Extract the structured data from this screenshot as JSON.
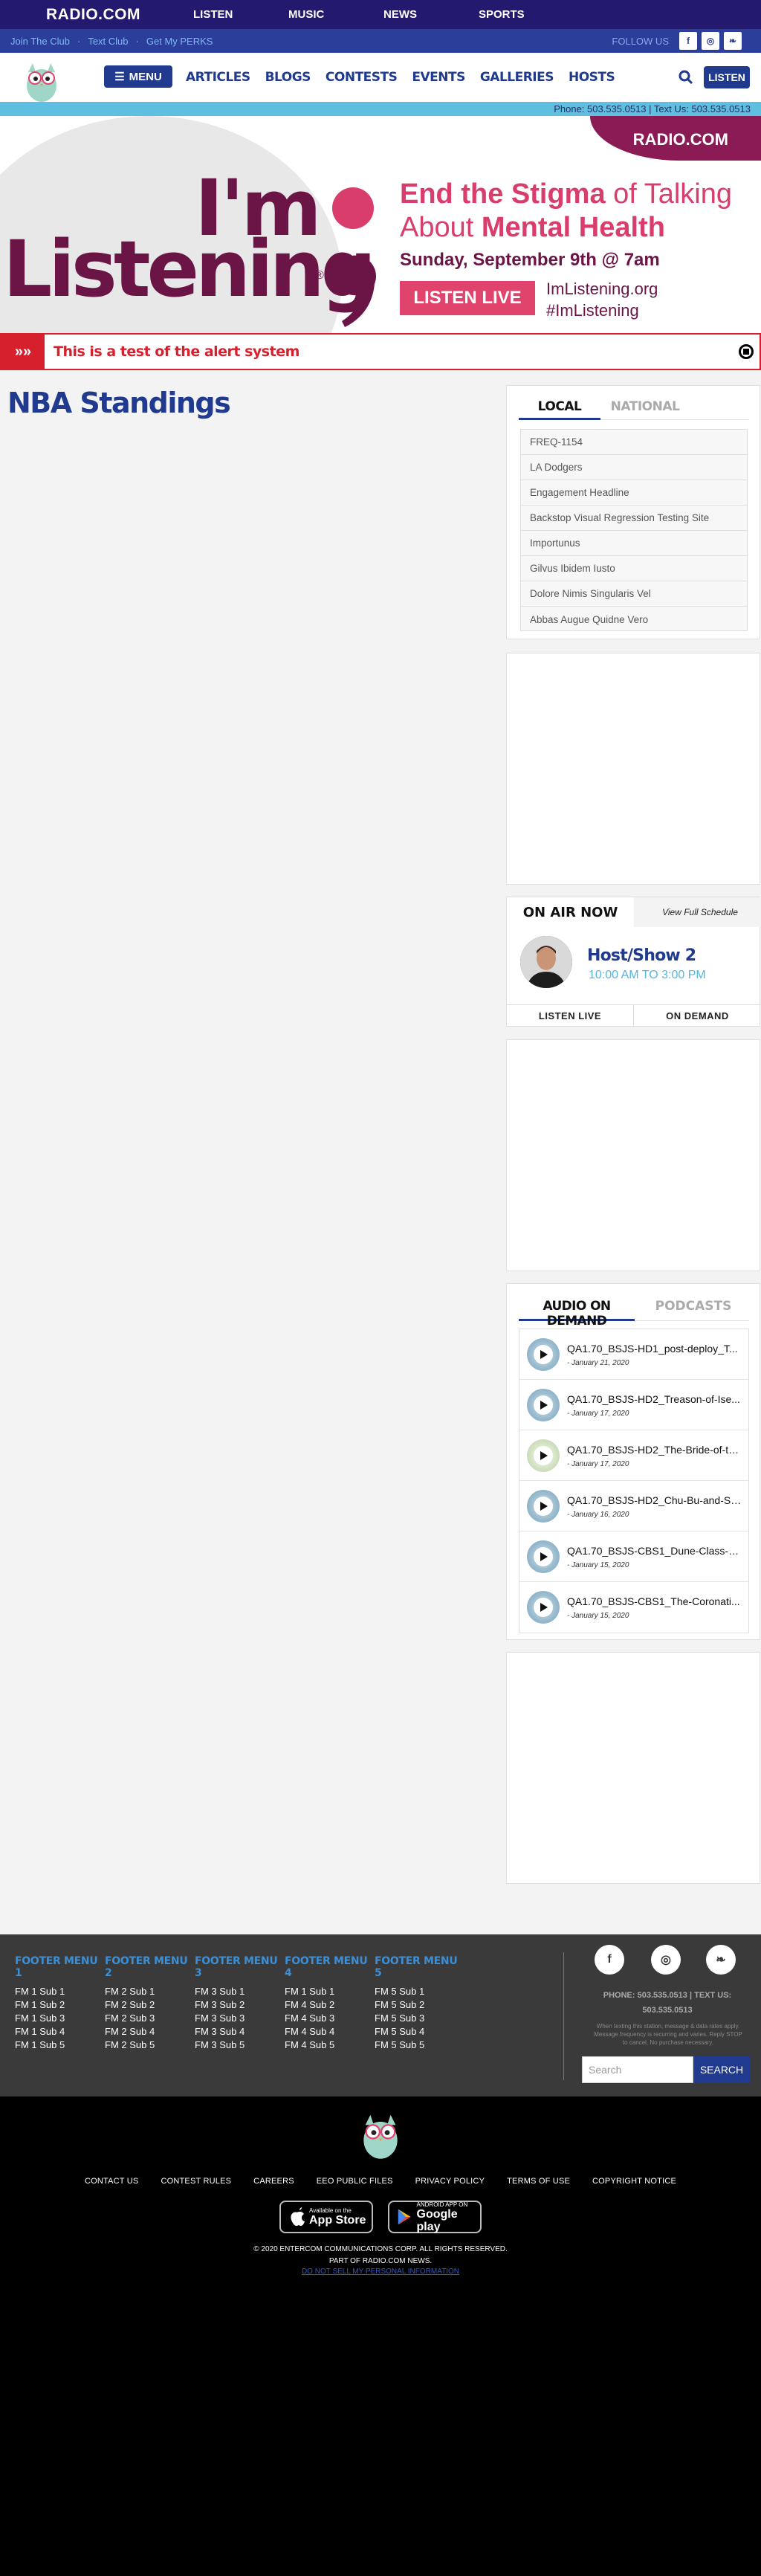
{
  "topnav": {
    "logo": "RADIO.COM",
    "items": [
      "LISTEN",
      "MUSIC",
      "NEWS",
      "SPORTS"
    ]
  },
  "clubbar": {
    "links": [
      "Join The Club",
      "Text Club",
      "Get My PERKS"
    ],
    "follow_label": "FOLLOW US",
    "social": [
      "f",
      "◎",
      "❧"
    ]
  },
  "station": {
    "menu_label": "MENU",
    "nav": [
      "ARTICLES",
      "BLOGS",
      "CONTESTS",
      "EVENTS",
      "GALLERIES",
      "HOSTS"
    ],
    "listen_label": "LISTEN",
    "phone_line": "Phone: 503.535.0513  |  Text Us: 503.535.0513"
  },
  "banner": {
    "radio_logo": "RADIO.COM",
    "im": "I'm",
    "listening": "Listening",
    "reg": "®",
    "headline_a": "End the Stigma",
    "headline_b": " of Talking",
    "headline_c": "About ",
    "headline_d": "Mental Health",
    "date": "Sunday, September 9th @ 7am",
    "cta": "LISTEN LIVE",
    "site": "ImListening.org",
    "hashtag": "#ImListening",
    "colors": {
      "plum": "#6b1547",
      "pink": "#e0446d"
    }
  },
  "alert": {
    "text": "This is a test of the alert system"
  },
  "page": {
    "title": "NBA Standings"
  },
  "trending": {
    "tabs": [
      "LOCAL",
      "NATIONAL"
    ],
    "items": [
      "FREQ-1154",
      "LA Dodgers",
      "Engagement Headline",
      "Backstop Visual Regression Testing Site",
      "Importunus",
      "Gilvus Ibidem Iusto",
      "Dolore Nimis Singularis Vel",
      "Abbas Augue Quidne Vero"
    ]
  },
  "onair": {
    "label": "ON AIR NOW",
    "schedule_link": "View Full Schedule",
    "host": "Host/Show 2",
    "time": "10:00 AM TO 3:00 PM",
    "buttons": [
      "LISTEN LIVE",
      "ON DEMAND"
    ]
  },
  "aod": {
    "tabs": [
      "AUDIO ON DEMAND",
      "PODCASTS"
    ],
    "items": [
      {
        "title": "QA1.70_BSJS-HD1_post-deploy_T...",
        "date": "- January 21, 2020"
      },
      {
        "title": "QA1.70_BSJS-HD2_Treason-of-Ise...",
        "date": "- January 17, 2020"
      },
      {
        "title": "QA1.70_BSJS-HD2_The-Bride-of-th...",
        "date": "- January 17, 2020"
      },
      {
        "title": "QA1.70_BSJS-HD2_Chu-Bu-and-Sh...",
        "date": "- January 16, 2020"
      },
      {
        "title": "QA1.70_BSJS-CBS1_Dune-Class-1...",
        "date": "- January 15, 2020"
      },
      {
        "title": "QA1.70_BSJS-CBS1_The-Coronati...",
        "date": "- January 15, 2020"
      }
    ]
  },
  "footer": {
    "menus": [
      {
        "title": "FOOTER MENU 1",
        "items": [
          "FM 1 Sub 1",
          "FM 1 Sub 2",
          "FM 1 Sub 3",
          "FM 1 Sub 4",
          "FM 1 Sub 5"
        ]
      },
      {
        "title": "FOOTER MENU 2",
        "items": [
          "FM 2 Sub 1",
          "FM 2 Sub 2",
          "FM 2 Sub 3",
          "FM 2 Sub 4",
          "FM 2 Sub 5"
        ]
      },
      {
        "title": "FOOTER MENU 3",
        "items": [
          "FM 3 Sub 1",
          "FM 3 Sub 2",
          "FM 3 Sub 3",
          "FM 3 Sub 4",
          "FM 3 Sub 5"
        ]
      },
      {
        "title": "FOOTER MENU 4",
        "items": [
          "FM 1 Sub 1",
          "FM 4 Sub 2",
          "FM 4 Sub 3",
          "FM 4 Sub 4",
          "FM 4 Sub 5"
        ]
      },
      {
        "title": "FOOTER MENU 5",
        "items": [
          "FM 5 Sub 1",
          "FM 5 Sub 2",
          "FM 5 Sub 3",
          "FM 5 Sub 4",
          "FM 5 Sub 5"
        ]
      }
    ],
    "social": [
      "f",
      "◎",
      "❧"
    ],
    "phone": "PHONE: 503.535.0513 | TEXT US: 503.535.0513",
    "disclaimer": "When texting this station, message & data rates apply. Message frequency is recurring and varies. Reply STOP to cancel. No purchase necessary.",
    "search_placeholder": "Search",
    "search_button": "SEARCH"
  },
  "bottom": {
    "links": [
      "CONTACT US",
      "CONTEST RULES",
      "CAREERS",
      "EEO PUBLIC FILES",
      "PRIVACY POLICY",
      "TERMS OF USE",
      "COPYRIGHT NOTICE"
    ],
    "appstore_small": "Available on the",
    "appstore_big": "App Store",
    "gplay_small": "ANDROID APP ON",
    "gplay_big": "Google play",
    "copyright": "© 2020 ENTERCOM COMMUNICATIONS CORP. ALL RIGHTS RESERVED.",
    "part_of": "PART OF RADIO.COM NEWS.",
    "dnsl": "DO NOT SELL MY PERSONAL INFORMATION"
  }
}
